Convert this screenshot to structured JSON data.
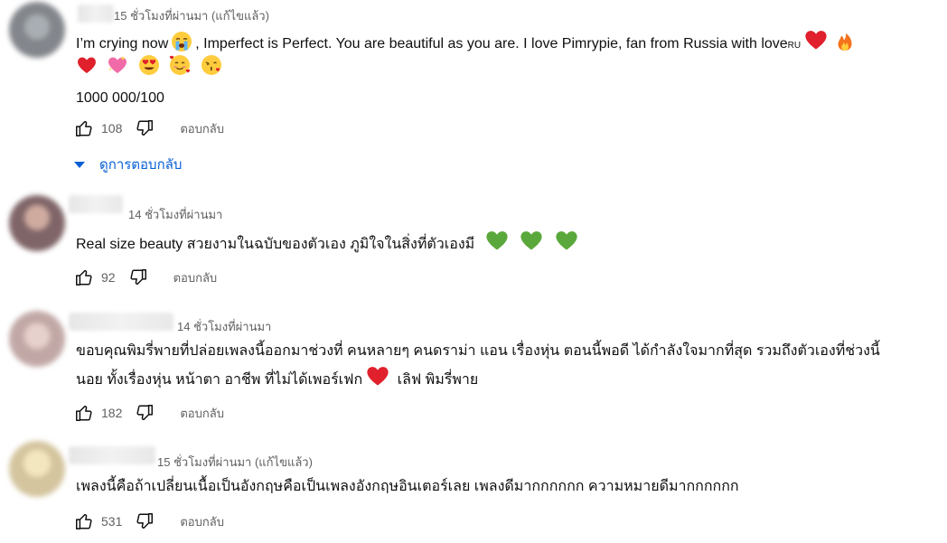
{
  "comments": [
    {
      "time": "15 ชั่วโมงที่ผ่านมา (แก้ไขแล้ว)",
      "text_line1_a": "I’m crying now",
      "text_line1_b": ", Imperfect is Perfect. You are beautiful as you are. I love Pimrypie, fan from Russia with love",
      "text_line1_ru": "RU",
      "text_line3": "1000 000/100",
      "likes": "108",
      "reply_label": "ตอบกลับ",
      "view_replies": "ดูการตอบกลับ"
    },
    {
      "time": "14 ชั่วโมงที่ผ่านมา",
      "text": "Real size beauty สวยงามในฉบับของตัวเอง ภูมิใจในสิ่งที่ตัวเองมี",
      "likes": "92",
      "reply_label": "ตอบกลับ"
    },
    {
      "time": "14 ชั่วโมงที่ผ่านมา",
      "text_line1": "ขอบคุณพิมรี่พายที่ปล่อยเพลงนี้ออกมาช่วงที่ คนหลายๆ คนดราม่า แอน เรื่องหุ่น ตอนนี้พอดี ได้กำลังใจมากที่สุด รวมถึงตัวเองที่ช่วงนี้",
      "text_line2_a": "นอย ทั้งเรื่องหุ่น หน้าตา อาชีพ ที่ไม่ได้เพอร์เฟก",
      "text_line2_b": " เลิฟ พิมรี่พาย",
      "likes": "182",
      "reply_label": "ตอบกลับ"
    },
    {
      "time": "15 ชั่วโมงที่ผ่านมา (แก้ไขแล้ว)",
      "text": "เพลงนี้คือถ้าเปลี่ยนเนื้อเป็นอังกฤษคือเป็นเพลงอังกฤษอินเตอร์เลย เพลงดีมากกกกกก ความหมายดีมากกกกกก",
      "likes": "531",
      "reply_label": "ตอบกลับ"
    }
  ],
  "colors": {
    "link": "#065fd4",
    "meta": "#606060",
    "text": "#0f0f0f"
  }
}
